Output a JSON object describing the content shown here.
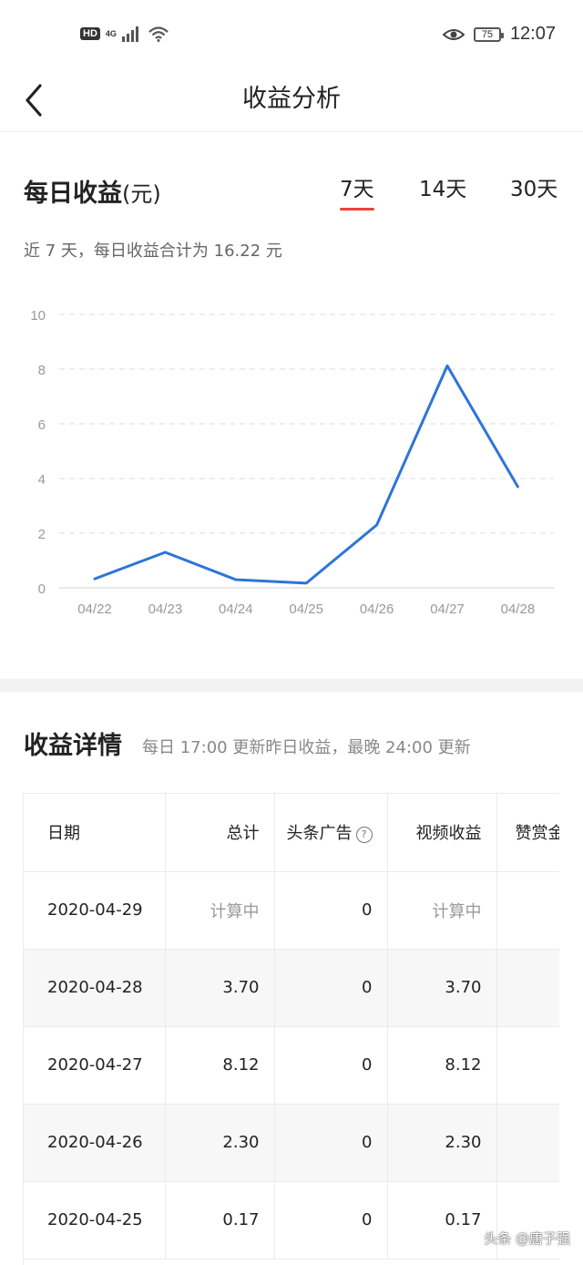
{
  "status_bar": {
    "hd": "HD",
    "network": "4G",
    "battery": "75",
    "time": "12:07"
  },
  "header": {
    "title": "收益分析"
  },
  "daily": {
    "title": "每日收益",
    "unit": "(元)",
    "periods": [
      "7天",
      "14天",
      "30天"
    ],
    "active_period": "7天",
    "summary": "近 7 天，每日收益合计为 16.22 元"
  },
  "chart_data": {
    "type": "line",
    "categories": [
      "04/22",
      "04/23",
      "04/24",
      "04/25",
      "04/26",
      "04/27",
      "04/28"
    ],
    "series": [
      {
        "values": [
          0.33,
          1.3,
          0.3,
          0.17,
          2.3,
          8.12,
          3.7
        ]
      }
    ],
    "y_ticks": [
      0,
      2,
      4,
      6,
      8,
      10
    ],
    "ylim": [
      0,
      10
    ],
    "grid": "dashed-horizontal",
    "line_color": "#2f74d8",
    "title": "",
    "xlabel": "",
    "ylabel": ""
  },
  "details": {
    "title": "收益详情",
    "note": "每日 17:00 更新昨日收益，最晚 24:00 更新",
    "columns": [
      "日期",
      "总计",
      "头条广告",
      "视频收益",
      "赞赏金"
    ],
    "rows": [
      [
        "2020-04-29",
        "计算中",
        "0",
        "计算中",
        ""
      ],
      [
        "2020-04-28",
        "3.70",
        "0",
        "3.70",
        ""
      ],
      [
        "2020-04-27",
        "8.12",
        "0",
        "8.12",
        ""
      ],
      [
        "2020-04-26",
        "2.30",
        "0",
        "2.30",
        ""
      ],
      [
        "2020-04-25",
        "0.17",
        "0",
        "0.17",
        ""
      ]
    ]
  },
  "watermark": "头条 @唐子强",
  "colors": {
    "accent_red": "#e8453c",
    "line_blue": "#2f74d8"
  }
}
